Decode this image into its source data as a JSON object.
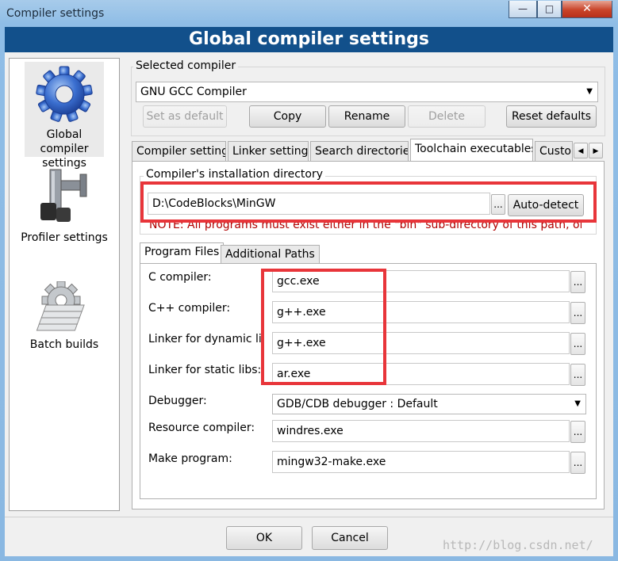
{
  "window": {
    "title": "Compiler settings",
    "caption_buttons": [
      "—",
      "□",
      "✕"
    ]
  },
  "header": {
    "title": "Global compiler settings"
  },
  "nav": {
    "items": [
      {
        "label_line1": "Global compiler",
        "label_line2": "settings",
        "icon": "gear-icon"
      },
      {
        "label_line1": "Profiler settings",
        "icon": "caliper-icon"
      },
      {
        "label_line1": "Batch builds",
        "icon": "stack-gear-icon"
      }
    ]
  },
  "selected_compiler": {
    "label": "Selected compiler",
    "value": "GNU GCC Compiler"
  },
  "actions": {
    "set_default": "Set as default",
    "copy": "Copy",
    "rename": "Rename",
    "delete": "Delete",
    "reset_defaults": "Reset defaults"
  },
  "tabs": [
    "Compiler settings",
    "Linker settings",
    "Search directories",
    "Toolchain executables",
    "Custom"
  ],
  "tab_scroll": {
    "left": "◀",
    "right": "▶"
  },
  "install_dir": {
    "label": "Compiler's installation directory",
    "value": "D:\\CodeBlocks\\MinGW",
    "browse": "...",
    "autodetect": "Auto-detect",
    "note": "NOTE: All programs must exist either in the \"bin\" sub-directory of this path, or in"
  },
  "subtabs": [
    "Program Files",
    "Additional Paths"
  ],
  "programs": [
    {
      "label": "C compiler:",
      "value": "gcc.exe"
    },
    {
      "label": "C++ compiler:",
      "value": "g++.exe"
    },
    {
      "label": "Linker for dynamic libs:",
      "value": "g++.exe"
    },
    {
      "label": "Linker for static libs:",
      "value": "ar.exe"
    },
    {
      "label": "Debugger:",
      "value": "GDB/CDB debugger : Default"
    },
    {
      "label": "Resource compiler:",
      "value": "windres.exe"
    },
    {
      "label": "Make program:",
      "value": "mingw32-make.exe"
    }
  ],
  "browse_label": "...",
  "footer": {
    "ok": "OK",
    "cancel": "Cancel"
  },
  "watermark": "http://blog.csdn.net/",
  "colors": {
    "header": "#12508b",
    "highlight": "#e8353a"
  }
}
